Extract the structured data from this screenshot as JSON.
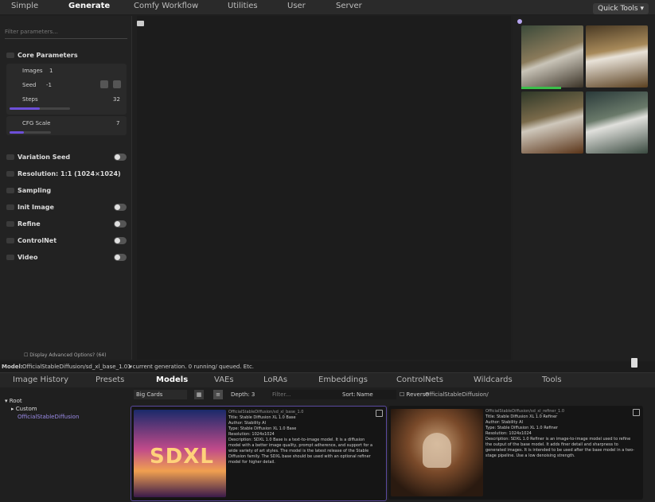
{
  "top_nav": {
    "tabs": [
      "Simple",
      "Generate",
      "Comfy Workflow",
      "Utilities",
      "User",
      "Server"
    ],
    "quick_tools": "Quick Tools ▾"
  },
  "left_panel": {
    "filter_placeholder": "Filter parameters...",
    "core_parameters": {
      "title": "Core Parameters",
      "images_label": "Images",
      "images_value": "1",
      "seed_label": "Seed",
      "seed_value": "-1",
      "steps_label": "Steps",
      "steps_value": "32",
      "steps_fraction": 0.5,
      "cfg_label": "CFG Scale",
      "cfg_value": "7",
      "cfg_fraction": 0.35
    },
    "sections": [
      {
        "label": "Variation Seed",
        "toggle": true
      },
      {
        "label": "Resolution: 1:1 (1024×1024)",
        "toggle": false
      },
      {
        "label": "Sampling",
        "toggle": false
      },
      {
        "label": "Init Image",
        "toggle": true
      },
      {
        "label": "Refine",
        "toggle": true
      },
      {
        "label": "ControlNet",
        "toggle": true
      },
      {
        "label": "Video",
        "toggle": true
      }
    ],
    "advanced_checkbox": "Display Advanced Options? (64)"
  },
  "status": {
    "model_label": "Model:",
    "model_value": "OfficialStableDiffusion/sd_xl_base_1.0 ▾",
    "generation_info": "1 current generation. 0 running/ queued. Etc."
  },
  "bottom_tabs": [
    "Image History",
    "Presets",
    "Models",
    "VAEs",
    "LoRAs",
    "Embeddings",
    "ControlNets",
    "Wildcards",
    "Tools"
  ],
  "tree": {
    "root": "Root",
    "child": "Custom",
    "grandchild": "OfficialStableDiffusion"
  },
  "toolbar": {
    "view_mode": "Big Cards",
    "depth_label": "Depth: 3",
    "filter_placeholder": "Filter...",
    "sort_label": "Sort:",
    "sort_value": "Name",
    "reverse_label": "Reverse",
    "path": "OfficialStableDiffusion/"
  },
  "cards": [
    {
      "header": "OfficialStableDiffusion/sd_xl_base_1.0",
      "title": "Title: Stable Diffusion XL 1.0 Base",
      "author": "Author: Stability AI",
      "type": "Type: Stable Diffusion XL 1.0 Base",
      "resolution": "Resolution: 1024x1024",
      "description": "Description: SDXL 1.0 Base is a text-to-image model. It is a diffusion model with a better image quality, prompt adherence, and support for a wide variety of art styles. The model is the latest release of the Stable Diffusion family. The SDXL base should be used with an optional refiner model for higher detail.",
      "image_text": "SDXL"
    },
    {
      "header": "OfficialStableDiffusion/sd_xl_refiner_1.0",
      "title": "Title: Stable Diffusion XL 1.0 Refiner",
      "author": "Author: Stability AI",
      "type": "Type: Stable Diffusion XL 1.0 Refiner",
      "resolution": "Resolution: 1024x1024",
      "description": "Description: SDXL 1.0 Refiner is an image-to-image model used to refine the output of the base model. It adds finer detail and sharpness to generated images. It is intended to be used after the base model in a two-stage pipeline. Use a low denoising strength.",
      "image_text": ""
    }
  ],
  "colors": {
    "accent": "#6d4fd8",
    "background": "#1f1f1f",
    "selected_card_border": "#5a4aa0"
  }
}
